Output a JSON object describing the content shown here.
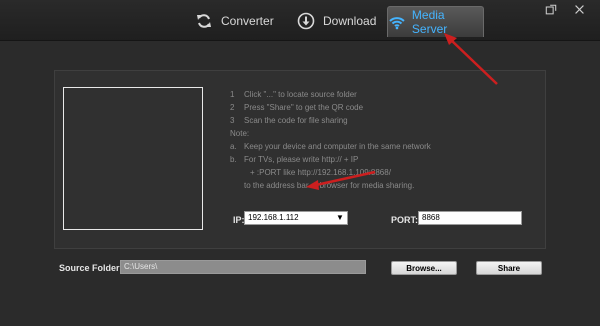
{
  "tabs": [
    {
      "label": "Converter",
      "icon": "refresh-icon"
    },
    {
      "label": "Download",
      "icon": "download-icon"
    },
    {
      "label": "Media Server",
      "icon": "wifi-icon",
      "active": true
    }
  ],
  "window_controls": {
    "restore_icon": "restore-icon",
    "close_icon": "close-icon"
  },
  "instructions": {
    "step1_num": "1",
    "step1": "Click \"...\" to locate source folder",
    "step2_num": "2",
    "step2": "Press \"Share\" to get the QR code",
    "step3_num": "3",
    "step3": "Scan the code for file sharing",
    "note_title": "Note:",
    "note_a_num": "a.",
    "note_a": "Keep your device and computer in the same network",
    "note_b_num": "b.",
    "note_b": "For TVs, please write http:// + IP",
    "note_b2": "+ :PORT like http://192.168.1.109:8868/",
    "note_b3": "to the address bar of browser for media sharing."
  },
  "ip": {
    "label": "IP:",
    "value": "192.168.1.112"
  },
  "port": {
    "label": "PORT:",
    "value": "8868"
  },
  "source_folder": {
    "label": "Source Folder:",
    "value": "C:\\Users\\"
  },
  "buttons": {
    "browse": "Browse...",
    "share": "Share"
  },
  "colors": {
    "accent": "#45b4ff",
    "annotation_arrow": "#cc1f1f"
  }
}
